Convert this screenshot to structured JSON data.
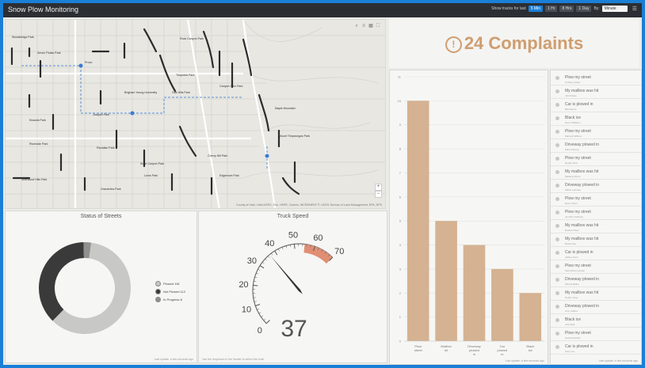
{
  "header": {
    "title": "Snow Plow Monitoring",
    "show_tracks_label": "Show tracks for last",
    "range_buttons": [
      "5 Min",
      "1 Hr",
      "8 Hrs",
      "1 Day"
    ],
    "active_range": "5 Min",
    "by_label": "By:",
    "by_select": "Minute"
  },
  "map": {
    "attribution": "County of Utah, Utah AGRC, Esri, HERE, Garmin, INCREMENT P, USGS, Bureau of Land Management, EPA, NPS",
    "places": [
      "Woodbridge Park",
      "Seven Peaks Park",
      "Rock Canyon Park",
      "Canyon Glen Park",
      "Provo",
      "Timpview Park",
      "Oak Hills Park",
      "Slate Canyon Park",
      "Maple Mountain",
      "Mount Timpanogos Park",
      "Kiwanis Park",
      "Joaquin Park",
      "Riverside Park",
      "Paradise Park",
      "Cherry Hill Park",
      "Lions Park",
      "Brigham Young University",
      "Sherwood Hills Park",
      "Edgemont Park",
      "Grandview Park"
    ]
  },
  "status_of_streets": {
    "title": "Status of Streets",
    "legend": [
      {
        "label": "Plowed 181",
        "color": "#c8c8c6"
      },
      {
        "label": "Not Plowed 112",
        "color": "#3a3a3a"
      },
      {
        "label": "In Progress 8",
        "color": "#909090"
      }
    ],
    "note": "Last update: a few seconds ago"
  },
  "truck_speed": {
    "title": "Truck Speed",
    "value": 37,
    "min": 0,
    "max": 70,
    "ticks": [
      "0",
      "10",
      "20",
      "30",
      "40",
      "50",
      "60",
      "70"
    ],
    "redzone_start": 55,
    "note": "Use the dropdown in the header to select the truck"
  },
  "complaints": {
    "count_text": "24 Complaints",
    "icon": "exclamation-circle-icon"
  },
  "chart_data": {
    "type": "bar",
    "categories": [
      "Plow street",
      "Mailbox hit",
      "Driveway plowed in",
      "Car plowed in",
      "Black ice"
    ],
    "values": [
      10,
      5,
      4,
      3,
      2
    ],
    "ylim": [
      0,
      11
    ],
    "yticks": [
      "0",
      "1",
      "2",
      "3",
      "4",
      "5",
      "6",
      "7",
      "8",
      "9",
      "10",
      "11"
    ],
    "bar_color": "#d4b292",
    "grid": true,
    "note": "Last update: a few seconds ago"
  },
  "complaint_list": {
    "items": [
      {
        "title": "Plow my street",
        "sub": "Lindsey Carter"
      },
      {
        "title": "My mailbox was hit",
        "sub": "John Moss"
      },
      {
        "title": "Car is plowed in",
        "sub": "Bob Moore"
      },
      {
        "title": "Black ice",
        "sub": "Kevin Williams"
      },
      {
        "title": "Plow my street",
        "sub": "Marcela Wilkins"
      },
      {
        "title": "Driveway plowed in",
        "sub": "Matt Johnson"
      },
      {
        "title": "Plow my street",
        "sub": "Neville Ortiz"
      },
      {
        "title": "My mailbox was hit",
        "sub": "Melanie Norris"
      },
      {
        "title": "Driveway plowed in",
        "sub": "Martin Lehman"
      },
      {
        "title": "Plow my street",
        "sub": "Dave Olsen"
      },
      {
        "title": "Plow my street",
        "sub": "Jennifer Cullinary"
      },
      {
        "title": "My mailbox was hit",
        "sub": "Rachel Olsen"
      },
      {
        "title": "My mailbox was hit",
        "sub": "Bryan Neo"
      },
      {
        "title": "Car is plowed in",
        "sub": "Jeffrey Dunn"
      },
      {
        "title": "Plow my street",
        "sub": "Samantha Lamsen"
      },
      {
        "title": "Driveway plowed in",
        "sub": "Wendy Baker"
      },
      {
        "title": "My mailbox was hit",
        "sub": "Robert Gray"
      },
      {
        "title": "Driveway plowed in",
        "sub": "Amy Collins"
      },
      {
        "title": "Black ice",
        "sub": "Joao Bell"
      },
      {
        "title": "Plow my street",
        "sub": "Hannah Evans"
      },
      {
        "title": "Car is plowed in",
        "sub": "Gary Lee"
      }
    ],
    "note": "Last update: a few seconds ago"
  }
}
